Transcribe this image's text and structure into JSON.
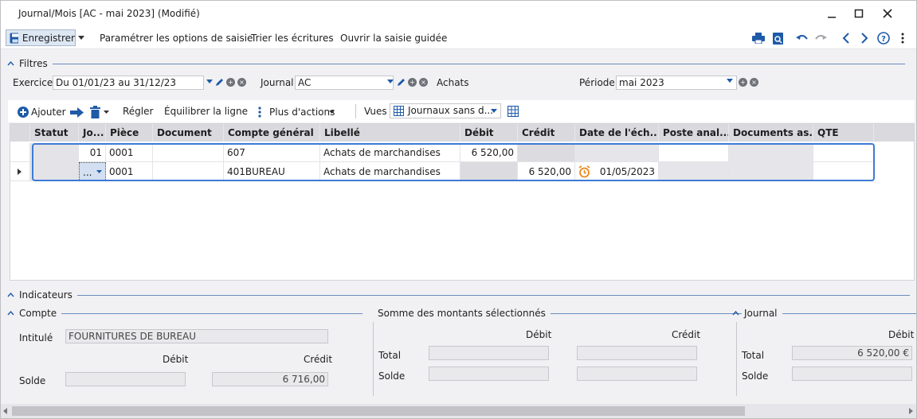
{
  "window": {
    "title": "Journal/Mois [AC - mai 2023] (Modifié)"
  },
  "toolbar": {
    "save_label": "Enregistrer",
    "items": [
      "Paramétrer les options de saisie",
      "Trier les écritures",
      "Ouvrir la saisie guidée"
    ]
  },
  "filters": {
    "section_label": "Filtres",
    "exercice_label": "Exercice",
    "exercice_value": "Du 01/01/23 au 31/12/23",
    "journal_label": "Journal",
    "journal_value": "AC",
    "journal_name": "Achats",
    "periode_label": "Période",
    "periode_value": "mai 2023"
  },
  "grid_toolbar": {
    "add_label": "Ajouter",
    "regler_label": "Régler",
    "equilibrer_label": "Équilibrer la ligne",
    "more_label": "Plus d'actions",
    "vues_label": "Vues",
    "vues_value": "Journaux sans d..."
  },
  "grid": {
    "columns": [
      "Statut",
      "Jo...",
      "Pièce",
      "Document",
      "Compte général",
      "Libellé",
      "Débit",
      "Crédit",
      "Date de l'éch...",
      "Poste anal...",
      "Documents as...",
      "QTE"
    ],
    "rows": [
      {
        "statut": "",
        "jour": "01",
        "piece": "0001",
        "document": "",
        "compte": "607",
        "libelle": "Achats de marchandises",
        "debit": "6 520,00",
        "credit": "",
        "echeance": "",
        "poste": "",
        "docs": "",
        "qte": ""
      },
      {
        "statut": "",
        "jour": "...",
        "piece": "0001",
        "document": "",
        "compte": "401BUREAU",
        "libelle": "Achats de marchandises",
        "debit": "",
        "credit": "6 520,00",
        "echeance": "01/05/2023",
        "poste": "",
        "docs": "",
        "qte": ""
      }
    ]
  },
  "indicateurs": {
    "section_label": "Indicateurs",
    "compte": {
      "label": "Compte",
      "intitule_label": "Intitulé",
      "intitule_value": "FOURNITURES DE BUREAU",
      "debit_label": "Débit",
      "credit_label": "Crédit",
      "solde_label": "Solde",
      "solde_debit": "",
      "solde_credit": "6 716,00"
    },
    "somme": {
      "label": "Somme des montants sélectionnés",
      "debit_label": "Débit",
      "credit_label": "Crédit",
      "total_label": "Total",
      "solde_label": "Solde"
    },
    "journal": {
      "label": "Journal",
      "debit_label": "Débit",
      "total_label": "Total",
      "total_value": "6 520,00 €",
      "solde_label": "Solde"
    }
  },
  "colors": {
    "accent": "#1e5aa8",
    "selection_border": "#3d7ad6",
    "alarm": "#e8891d"
  }
}
